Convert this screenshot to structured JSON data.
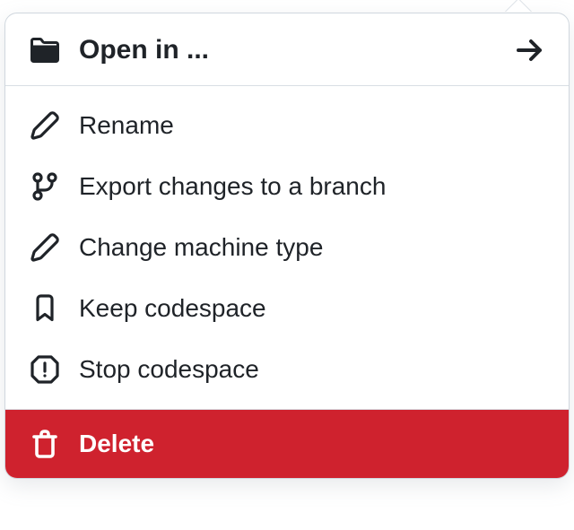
{
  "menu": {
    "open_in": "Open in ...",
    "items": [
      {
        "label": "Rename"
      },
      {
        "label": "Export changes to a branch"
      },
      {
        "label": "Change machine type"
      },
      {
        "label": "Keep codespace"
      },
      {
        "label": "Stop codespace"
      }
    ],
    "delete": "Delete"
  }
}
